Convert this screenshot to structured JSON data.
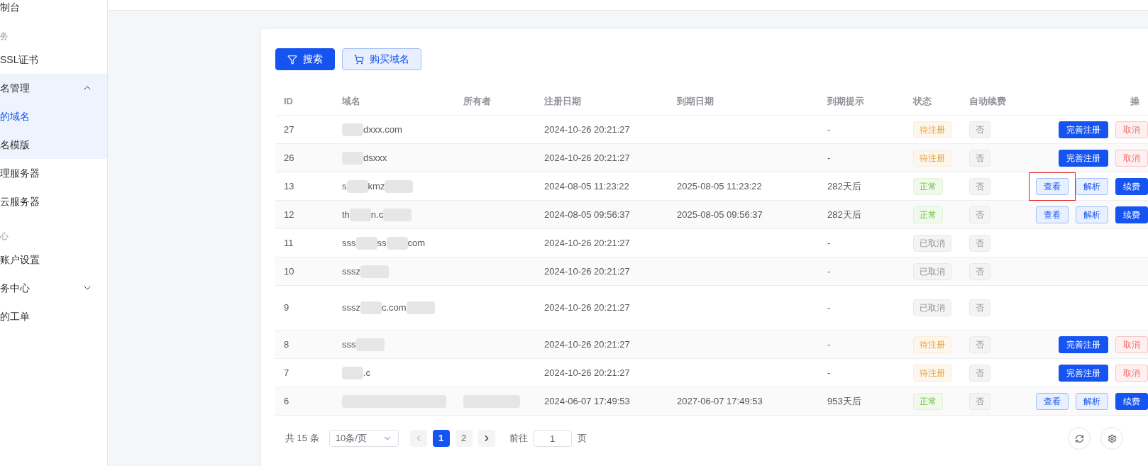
{
  "sidebar": {
    "items": [
      {
        "label": "制台",
        "kind": "item"
      },
      {
        "label": "务",
        "kind": "section"
      },
      {
        "label": "SSL证书",
        "kind": "item"
      },
      {
        "label": "名管理",
        "kind": "group",
        "expanded": true,
        "children": [
          {
            "label": "的域名",
            "selected": true
          },
          {
            "label": "名模版",
            "selected": false
          }
        ]
      },
      {
        "label": "理服务器",
        "kind": "item"
      },
      {
        "label": "云服务器",
        "kind": "item"
      },
      {
        "label": "心",
        "kind": "section"
      },
      {
        "label": "账户设置",
        "kind": "item"
      },
      {
        "label": "务中心",
        "kind": "group",
        "expanded": false
      },
      {
        "label": "的工单",
        "kind": "item"
      }
    ]
  },
  "toolbar": [
    {
      "label": "搜索",
      "kind": "primary"
    },
    {
      "label": "购买域名",
      "kind": "outline"
    }
  ],
  "table": {
    "columns": [
      "ID",
      "域名",
      "所有者",
      "注册日期",
      "到期日期",
      "到期提示",
      "状态",
      "自动续费",
      "操"
    ],
    "rows": [
      {
        "id": "27",
        "domain_parts": [
          "dxxx.com"
        ],
        "blur_first": true,
        "owner_blurred": false,
        "registered": "2024-10-26 20:21:27",
        "hint": "-",
        "status": {
          "label": "待注册",
          "kind": "pending"
        },
        "auto_renew": "否",
        "actions": [
          {
            "label": "完善注册",
            "kind": "primary"
          },
          {
            "label": "取消",
            "kind": "danger"
          }
        ]
      },
      {
        "id": "26",
        "domain_parts": [
          "dsxxx"
        ],
        "blur_first": true,
        "owner_blurred": false,
        "registered": "2024-10-26 20:21:27",
        "hint": "-",
        "status": {
          "label": "待注册",
          "kind": "pending"
        },
        "auto_renew": "否",
        "actions": [
          {
            "label": "完善注册",
            "kind": "primary"
          },
          {
            "label": "取消",
            "kind": "danger"
          }
        ]
      },
      {
        "id": "13",
        "domain_parts": [
          "s",
          "kmz"
        ],
        "blur_first": false,
        "owner_blurred": false,
        "registered": "2024-08-05 11:23:22",
        "expires": "2025-08-05 11:23:22",
        "hint": "282天后",
        "status": {
          "label": "正常",
          "kind": "normal"
        },
        "auto_renew": "否",
        "actions": [
          {
            "label": "查看",
            "kind": "outline",
            "annotated": true
          },
          {
            "label": "解析",
            "kind": "outline",
            "annotated": false
          },
          {
            "label": "续费",
            "kind": "primary"
          }
        ]
      },
      {
        "id": "12",
        "domain_parts": [
          "th",
          "n.c"
        ],
        "blur_first": false,
        "owner_blurred": false,
        "registered": "2024-08-05 09:56:37",
        "expires": "2025-08-05 09:56:37",
        "hint": "282天后",
        "status": {
          "label": "正常",
          "kind": "normal"
        },
        "auto_renew": "否",
        "actions": [
          {
            "label": "查看",
            "kind": "outline",
            "annotated": false
          },
          {
            "label": "解析",
            "kind": "outline",
            "annotated": false
          },
          {
            "label": "续费",
            "kind": "primary"
          }
        ]
      },
      {
        "id": "11",
        "domain_parts": [
          "sss",
          "ss",
          "com"
        ],
        "blur_first": false,
        "owner_blurred": false,
        "registered": "2024-10-26 20:21:27",
        "hint": "-",
        "status": {
          "label": "已取消",
          "kind": "cancelled"
        },
        "auto_renew": "否",
        "actions": []
      },
      {
        "id": "10",
        "domain_parts": [
          "sssz"
        ],
        "blur_first": false,
        "owner_blurred": false,
        "registered": "2024-10-26 20:21:27",
        "hint": "-",
        "status": {
          "label": "已取消",
          "kind": "cancelled"
        },
        "auto_renew": "否",
        "actions": []
      },
      {
        "id": "9",
        "domain_parts": [
          "sssz",
          "c.com"
        ],
        "blur_first": false,
        "owner_blurred": false,
        "registered": "2024-10-26 20:21:27",
        "hint": "-",
        "status": {
          "label": "已取消",
          "kind": "cancelled"
        },
        "auto_renew": "否",
        "actions": []
      },
      {
        "id": "8",
        "domain_parts": [
          "sss"
        ],
        "blur_first": false,
        "owner_blurred": false,
        "registered": "2024-10-26 20:21:27",
        "hint": "-",
        "status": {
          "label": "待注册",
          "kind": "pending"
        },
        "auto_renew": "否",
        "actions": [
          {
            "label": "完善注册",
            "kind": "primary"
          },
          {
            "label": "取消",
            "kind": "danger"
          }
        ]
      },
      {
        "id": "7",
        "domain_parts": [
          ".c"
        ],
        "blur_first": true,
        "owner_blurred": false,
        "registered": "2024-10-26 20:21:27",
        "hint": "-",
        "status": {
          "label": "待注册",
          "kind": "pending"
        },
        "auto_renew": "否",
        "actions": [
          {
            "label": "完善注册",
            "kind": "primary"
          },
          {
            "label": "取消",
            "kind": "danger"
          }
        ]
      },
      {
        "id": "6",
        "domain_parts": [],
        "blur_first": true,
        "owner_blurred": true,
        "registered": "2024-06-07 17:49:53",
        "expires": "2027-06-07 17:49:53",
        "hint": "953天后",
        "status": {
          "label": "正常",
          "kind": "normal"
        },
        "auto_renew": "否",
        "actions": [
          {
            "label": "查看",
            "kind": "outline",
            "annotated": false
          },
          {
            "label": "解析",
            "kind": "outline",
            "annotated": false
          },
          {
            "label": "续费",
            "kind": "primary"
          }
        ]
      }
    ]
  },
  "pagination": {
    "total": "共 15 条",
    "page_size": "10条/页",
    "prev_disabled": true,
    "pages": [
      {
        "label": "1",
        "selected": true
      },
      {
        "label": "2",
        "selected": false
      }
    ],
    "goto_label": "前往",
    "goto_value": "1",
    "page_suffix": "页"
  }
}
